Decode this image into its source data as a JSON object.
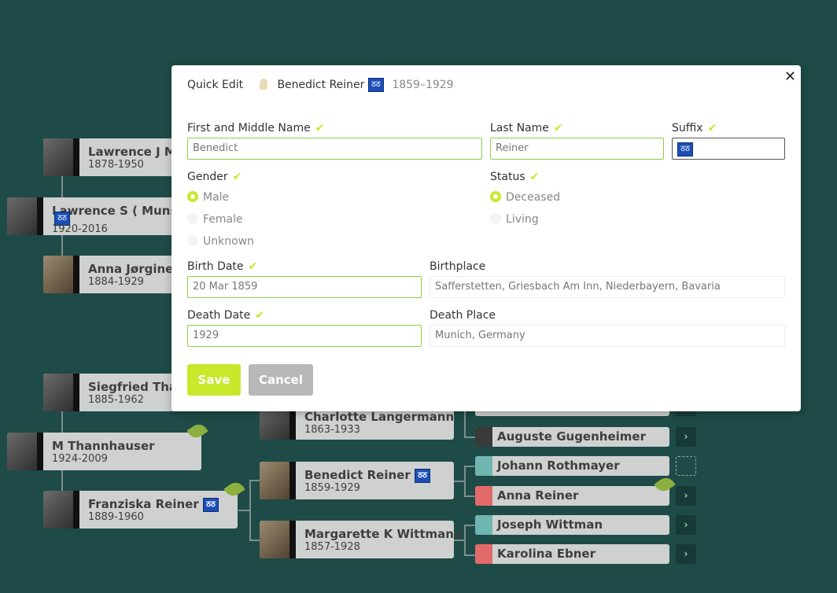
{
  "tree": {
    "people": [
      {
        "name": "Lawrence J Mu",
        "dates": "1878-1950"
      },
      {
        "name": "Lawrence S ( Munson",
        "dates": "1920-2016",
        "suffix": "ठठ"
      },
      {
        "name": "Anna Jørgine L",
        "dates": "1884-1929"
      },
      {
        "name": "Siegfried Thar",
        "dates": "1885-1962"
      },
      {
        "name": "M Thannhauser",
        "dates": "1924-2009"
      },
      {
        "name": "Franziska Reiner",
        "dates": "1889-1960",
        "suffix": "ठठ"
      },
      {
        "name": "Charlotte Langermann",
        "dates": "1863-1933"
      },
      {
        "name": "Benedict Reiner",
        "dates": "1859-1929",
        "suffix": "ठठ"
      },
      {
        "name": "Margarette K Wittmann",
        "dates": "1857-1928"
      }
    ],
    "ancestors": [
      {
        "name": "Auguste Gugenheimer"
      },
      {
        "name": "Johann Rothmayer"
      },
      {
        "name": "Anna Reiner"
      },
      {
        "name": "Joseph Wittman"
      },
      {
        "name": "Karolina Ebner"
      }
    ],
    "arrow_icon": "›"
  },
  "modal": {
    "title": "Quick Edit",
    "person_name": "Benedict Reiner",
    "person_suffix": "ठठ",
    "person_dates": "1859–1929",
    "close_icon": "✕",
    "fields": {
      "first_name_label": "First and Middle Name",
      "first_name_value": "Benedict",
      "last_name_label": "Last Name",
      "last_name_value": "Reiner",
      "suffix_label": "Suffix",
      "suffix_value": "ठठ",
      "gender_label": "Gender",
      "gender_options": [
        "Male",
        "Female",
        "Unknown"
      ],
      "gender_selected": "Male",
      "status_label": "Status",
      "status_options": [
        "Deceased",
        "Living"
      ],
      "status_selected": "Deceased",
      "birth_date_label": "Birth Date",
      "birth_date_value": "20 Mar 1859",
      "birthplace_label": "Birthplace",
      "birthplace_value": "Safferstetten, Griesbach Am Inn, Niederbayern, Bavaria",
      "death_date_label": "Death Date",
      "death_date_value": "1929",
      "death_place_label": "Death Place",
      "death_place_value": "Munich, Germany"
    },
    "check_icon": "✔",
    "save_label": "Save",
    "cancel_label": "Cancel",
    "save_color": "#c8e82a",
    "cancel_color": "#b8b8b8"
  }
}
